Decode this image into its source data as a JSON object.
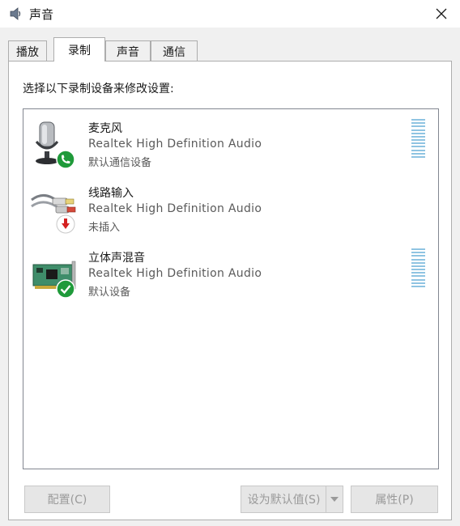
{
  "window": {
    "title": "声音",
    "title_icon": "speaker-icon",
    "close_icon": "close-icon"
  },
  "tabs": [
    {
      "label": "播放",
      "active": false
    },
    {
      "label": "录制",
      "active": true
    },
    {
      "label": "声音",
      "active": false
    },
    {
      "label": "通信",
      "active": false
    }
  ],
  "panel": {
    "instruction": "选择以下录制设备来修改设置:"
  },
  "devices": [
    {
      "name": "麦克风",
      "description": "Realtek High Definition Audio",
      "status": "默认通信设备",
      "icon": "microphone-icon",
      "badge": "phone-badge-icon"
    },
    {
      "name": "线路输入",
      "description": "Realtek High Definition Audio",
      "status": "未插入",
      "icon": "line-in-cable-icon",
      "badge": "unplugged-badge-icon"
    },
    {
      "name": "立体声混音",
      "description": "Realtek High Definition Audio",
      "status": "默认设备",
      "icon": "sound-card-icon",
      "badge": "checkmark-badge-icon"
    }
  ],
  "buttons": {
    "configure": "配置(C)",
    "set_default": "设为默认值(S)",
    "properties": "属性(P)"
  },
  "colors": {
    "level_meter": "#8fc4e2",
    "badge_green": "#1f9a3a",
    "badge_red": "#d42020"
  }
}
